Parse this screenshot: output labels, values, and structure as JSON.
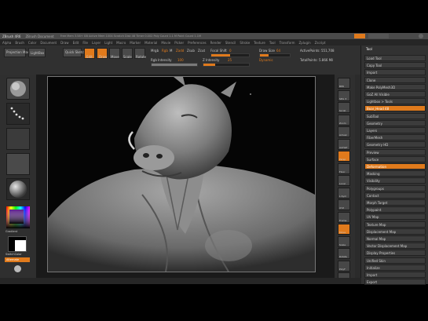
{
  "window": {
    "title": "ZBrush 4R6",
    "title_extra": "ZBrush Document",
    "title_status": "Free Mem 3.58+ GB  Active Mem 1004  Scratch Disk 48  Timer 0.002  Poly Count 1.1 M  Point Count 1.1M"
  },
  "menu": [
    "Alpha",
    "Brush",
    "Color",
    "Document",
    "Draw",
    "Edit",
    "File",
    "Layer",
    "Light",
    "Macro",
    "Marker",
    "Material",
    "Movie",
    "Picker",
    "Preferences",
    "Render",
    "Stencil",
    "Stroke",
    "Texture",
    "Tool",
    "Transform",
    "Zplugin",
    "Zscript"
  ],
  "toolbar": {
    "projection_master": "Projection Master",
    "lightbox": "LightBox",
    "quick_sketch": "Quick Sketch",
    "edit": "Edit",
    "draw": "Draw",
    "move": "Move",
    "scale": "Scale",
    "rotate": "Rotate",
    "mrgb": "Mrgb",
    "rgb": "Rgb",
    "m": "M",
    "zadd": "Zadd",
    "zsub": "Zsub",
    "zcut": "Zcut",
    "focal_shift_label": "Focal Shift",
    "focal_shift_value": "0",
    "z_intensity_label": "Z Intensity",
    "z_intensity_value": "25",
    "draw_size_label": "Draw Size",
    "draw_size_value": "64",
    "rgb_intensity_label": "Rgb Intensity",
    "rgb_intensity_value": "100",
    "dynamic": "Dynamic",
    "active_points": "ActivePoints: 551,708",
    "total_points": "TotalPoints: 5.866 Mil"
  },
  "left_shelf": {
    "brush": "Standard",
    "stroke": "Dots",
    "alpha": "Off",
    "texture": "Texture Off",
    "material": "MatCap Gray",
    "gradient": "Gradient",
    "switch_color": "SwitchColor",
    "alternate": "Alternate"
  },
  "right_shelf": [
    "BPR",
    "SPix 3",
    "Scroll",
    "Zoom",
    "Actual",
    "AAHalf",
    "Persp",
    "Floor",
    "Local",
    "L.Sym",
    "XYZ",
    "Frame",
    "Move",
    "Scale",
    "Rotate",
    "PolyF",
    "Transp",
    "Ghost",
    "Solo",
    "Xpose"
  ],
  "tray": {
    "header": "Tool",
    "rows": [
      {
        "label": "Load Tool",
        "orange": false
      },
      {
        "label": "Copy Tool",
        "orange": false
      },
      {
        "label": "Import",
        "orange": false
      },
      {
        "label": "Clone",
        "orange": false
      },
      {
        "label": "Make PolyMesh3D",
        "orange": false
      },
      {
        "label": "GoZ  All  Visible",
        "orange": false
      },
      {
        "label": "Lightbox > Tools",
        "orange": false
      },
      {
        "label": "Boar_Head  48",
        "orange": true
      },
      {
        "label": "SubTool",
        "orange": false
      },
      {
        "label": "Geometry",
        "orange": false
      },
      {
        "label": "Layers",
        "orange": false
      },
      {
        "label": "FiberMesh",
        "orange": false
      },
      {
        "label": "Geometry HD",
        "orange": false
      },
      {
        "label": "Preview",
        "orange": false
      },
      {
        "label": "Surface",
        "orange": false
      },
      {
        "label": "Deformation",
        "orange": true
      },
      {
        "label": "Masking",
        "orange": false
      },
      {
        "label": "Visibility",
        "orange": false
      },
      {
        "label": "Polygroups",
        "orange": false
      },
      {
        "label": "Contact",
        "orange": false
      },
      {
        "label": "Morph Target",
        "orange": false
      },
      {
        "label": "Polypaint",
        "orange": false
      },
      {
        "label": "UV Map",
        "orange": false
      },
      {
        "label": "Texture Map",
        "orange": false
      },
      {
        "label": "Displacement Map",
        "orange": false
      },
      {
        "label": "Normal Map",
        "orange": false
      },
      {
        "label": "Vector Displacement Map",
        "orange": false
      },
      {
        "label": "Display Properties",
        "orange": false
      },
      {
        "label": "Unified Skin",
        "orange": false
      },
      {
        "label": "Initialize",
        "orange": false
      },
      {
        "label": "Import",
        "orange": false
      },
      {
        "label": "Export",
        "orange": false
      }
    ]
  },
  "colors": {
    "accent": "#e07a1c",
    "panel": "#2f2f2f",
    "viewport": "#050505",
    "model": "#8a8a8a"
  }
}
